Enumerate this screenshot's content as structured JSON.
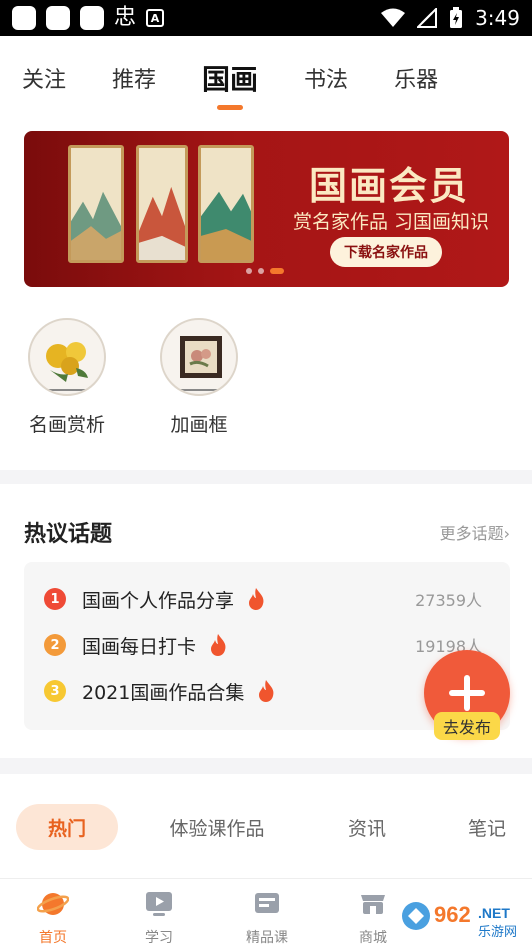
{
  "status_bar": {
    "time": "3:49",
    "left_glyph": "忠",
    "small_icon_letter": "A"
  },
  "top_tabs": [
    {
      "label": "关注",
      "active": false
    },
    {
      "label": "推荐",
      "active": false
    },
    {
      "label": "国画",
      "active": true
    },
    {
      "label": "书法",
      "active": false
    },
    {
      "label": "乐器",
      "active": false
    }
  ],
  "banner": {
    "title": "国画会员",
    "subtitle": "赏名家作品 习国画知识",
    "button_label": "下载名家作品",
    "active_dot": 2
  },
  "shortcuts": [
    {
      "label": "名画赏析",
      "icon": "chrysanthemum-painting-icon"
    },
    {
      "label": "加画框",
      "icon": "framed-painting-icon"
    }
  ],
  "hot_topics": {
    "title": "热议话题",
    "more_label": "更多话题",
    "items": [
      {
        "rank": "1",
        "name": "国画个人作品分享",
        "count": "27359人",
        "rank_color": "#ef4a36"
      },
      {
        "rank": "2",
        "name": "国画每日打卡",
        "count": "19198人",
        "rank_color": "#f39a3a"
      },
      {
        "rank": "3",
        "name": "2021国画作品合集",
        "count": "",
        "rank_color": "#f7c832"
      }
    ]
  },
  "fab": {
    "label": "去发布"
  },
  "category_tabs": [
    {
      "label": "热门",
      "active": true
    },
    {
      "label": "体验课作品",
      "active": false
    },
    {
      "label": "资讯",
      "active": false
    },
    {
      "label": "笔记",
      "active": false
    }
  ],
  "bottom_nav": [
    {
      "label": "首页",
      "icon": "home-planet-icon",
      "active": true
    },
    {
      "label": "学习",
      "icon": "play-video-icon",
      "active": false
    },
    {
      "label": "精品课",
      "icon": "course-book-icon",
      "active": false
    },
    {
      "label": "商城",
      "icon": "store-icon",
      "active": false
    }
  ],
  "watermark": {
    "text1": "962",
    "text2": ".NET",
    "text3": "乐游网"
  },
  "colors": {
    "accent": "#f4782c",
    "banner_red": "#a51515",
    "fab_red": "#f05a3a",
    "fab_label_yellow": "#fbd848"
  }
}
